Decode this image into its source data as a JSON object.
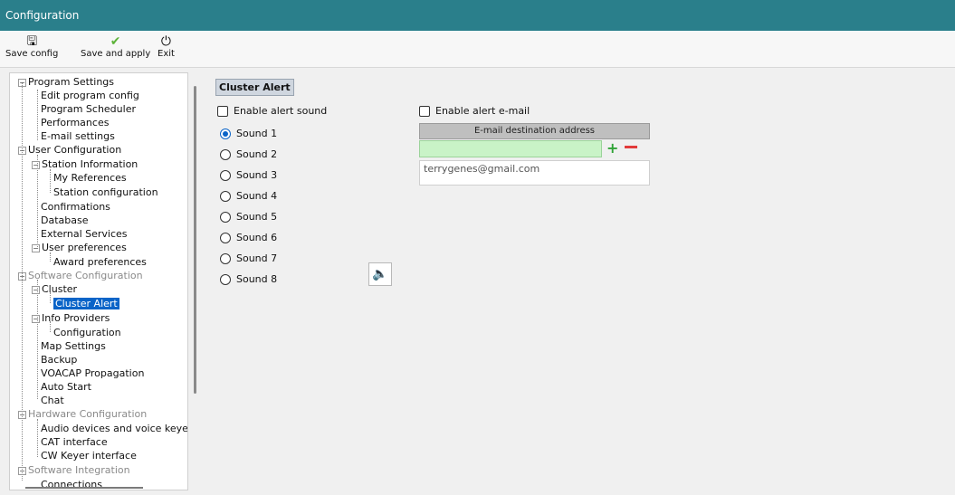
{
  "window": {
    "title": "Configuration"
  },
  "toolbar": {
    "save_config": "Save config",
    "save_apply": "Save and apply",
    "exit": "Exit"
  },
  "tree": {
    "program_settings": "Program Settings",
    "edit_program_config": "Edit program config",
    "program_scheduler": "Program Scheduler",
    "performances": "Performances",
    "email_settings": "E-mail settings",
    "user_configuration": "User Configuration",
    "station_information": "Station Information",
    "my_references": "My References",
    "station_configuration": "Station configuration",
    "confirmations": "Confirmations",
    "database": "Database",
    "external_services": "External Services",
    "user_preferences": "User preferences",
    "award_preferences": "Award preferences",
    "software_configuration": "Software Configuration",
    "cluster": "Cluster",
    "cluster_alert": "Cluster Alert",
    "info_providers": "Info Providers",
    "configuration": "Configuration",
    "map_settings": "Map Settings",
    "backup": "Backup",
    "voacap": "VOACAP Propagation",
    "auto_start": "Auto Start",
    "chat": "Chat",
    "hardware_configuration": "Hardware Configuration",
    "audio_devices": "Audio devices and voice keye",
    "cat_interface": "CAT interface",
    "cw_keyer": "CW Keyer interface",
    "software_integration": "Software Integration",
    "connections": "Connections"
  },
  "panel": {
    "title": "Cluster Alert",
    "enable_sound": "Enable alert sound",
    "enable_email": "Enable alert e-mail",
    "sounds": [
      "Sound 1",
      "Sound 2",
      "Sound 3",
      "Sound 4",
      "Sound 5",
      "Sound 6",
      "Sound 7",
      "Sound 8"
    ],
    "selected_sound": "Sound 1",
    "email_header": "E-mail destination address",
    "email_input_value": "",
    "emails": [
      "terrygenes@gmail.com"
    ]
  },
  "icons": {
    "save": "floppy-icon",
    "save_apply": "checkmark-icon",
    "exit": "power-icon",
    "play": "speaker-icon",
    "add": "plus-icon",
    "remove": "minus-icon"
  },
  "colors": {
    "titlebar": "#2a7f8b",
    "selection": "#0a64c8",
    "email_input_bg": "#c9f3c7",
    "add": "#2fa336",
    "remove": "#e23b3b"
  }
}
